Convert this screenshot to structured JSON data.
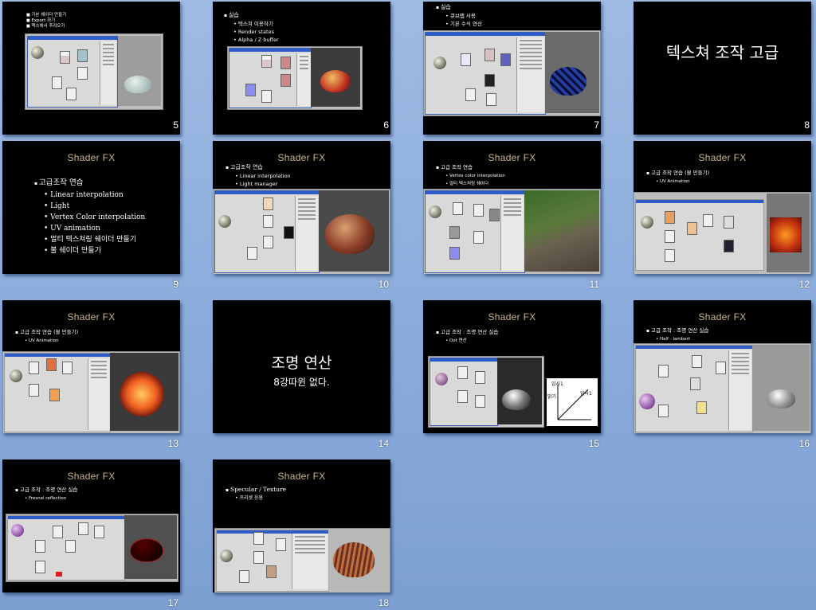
{
  "slides": [
    {
      "num": "5",
      "bullets": [
        "기본 쉐이더 만들기",
        "Export 하기",
        "맥스에서 추려오기"
      ]
    },
    {
      "num": "6",
      "bullets": [
        "실습"
      ],
      "sub": [
        "텍스쳐 이용하기",
        "Render states",
        "Alpha / Z buffer"
      ]
    },
    {
      "num": "7",
      "bullets": [
        "실습"
      ],
      "sub": [
        "큐브맵 사용",
        "기본 수식 연산"
      ]
    },
    {
      "num": "8",
      "title": "텍스쳐 조작 고급"
    },
    {
      "num": "9",
      "title": "Shader FX",
      "bullets": [
        "고급조작 연습"
      ],
      "sub": [
        "Linear interpolation",
        "Light",
        "Vertex Color interpolation",
        "UV animation",
        "멀티 텍스쳐링 쉐이더 만들기",
        "불 쉐이더 만들기"
      ]
    },
    {
      "num": "10",
      "title": "Shader FX",
      "bullets": [
        "고급조작 연습"
      ],
      "sub": [
        "Linear interpolation",
        "Light manager"
      ]
    },
    {
      "num": "11",
      "title": "Shader FX",
      "bullets": [
        "고급 조작 연습"
      ],
      "sub": [
        "Vertex color interpolation",
        "멀티 텍스처링 쉐이더"
      ]
    },
    {
      "num": "12",
      "title": "Shader FX",
      "bullets": [
        "고급 조작 연습 (불 만들기)"
      ],
      "sub": [
        "UV Animation"
      ]
    },
    {
      "num": "13",
      "title": "Shader FX",
      "bullets": [
        "고급 조작 연습 (불 만들기)"
      ],
      "sub": [
        "UV Animation"
      ]
    },
    {
      "num": "14",
      "title": "조명 연산",
      "subtitle": "8강따윈 없다."
    },
    {
      "num": "15",
      "title": "Shader FX",
      "bullets": [
        "고급 조작 : 조명 연산 실습"
      ],
      "sub": [
        "Dot 연산"
      ],
      "diagram": {
        "a": "입사1",
        "b": "입사1",
        "c": "밝기"
      }
    },
    {
      "num": "16",
      "title": "Shader FX",
      "bullets": [
        "고급 조작 : 조명 연산 실습"
      ],
      "sub": [
        "Half - lambert"
      ]
    },
    {
      "num": "17",
      "title": "Shader FX",
      "bullets": [
        "고급 조작 : 조명 연산 실습"
      ],
      "sub": [
        "Fresnel reflection"
      ]
    },
    {
      "num": "18",
      "title": "Shader FX",
      "bullets": [
        "Specular / Texture"
      ],
      "sub": [
        "프리셋 응용"
      ]
    }
  ]
}
